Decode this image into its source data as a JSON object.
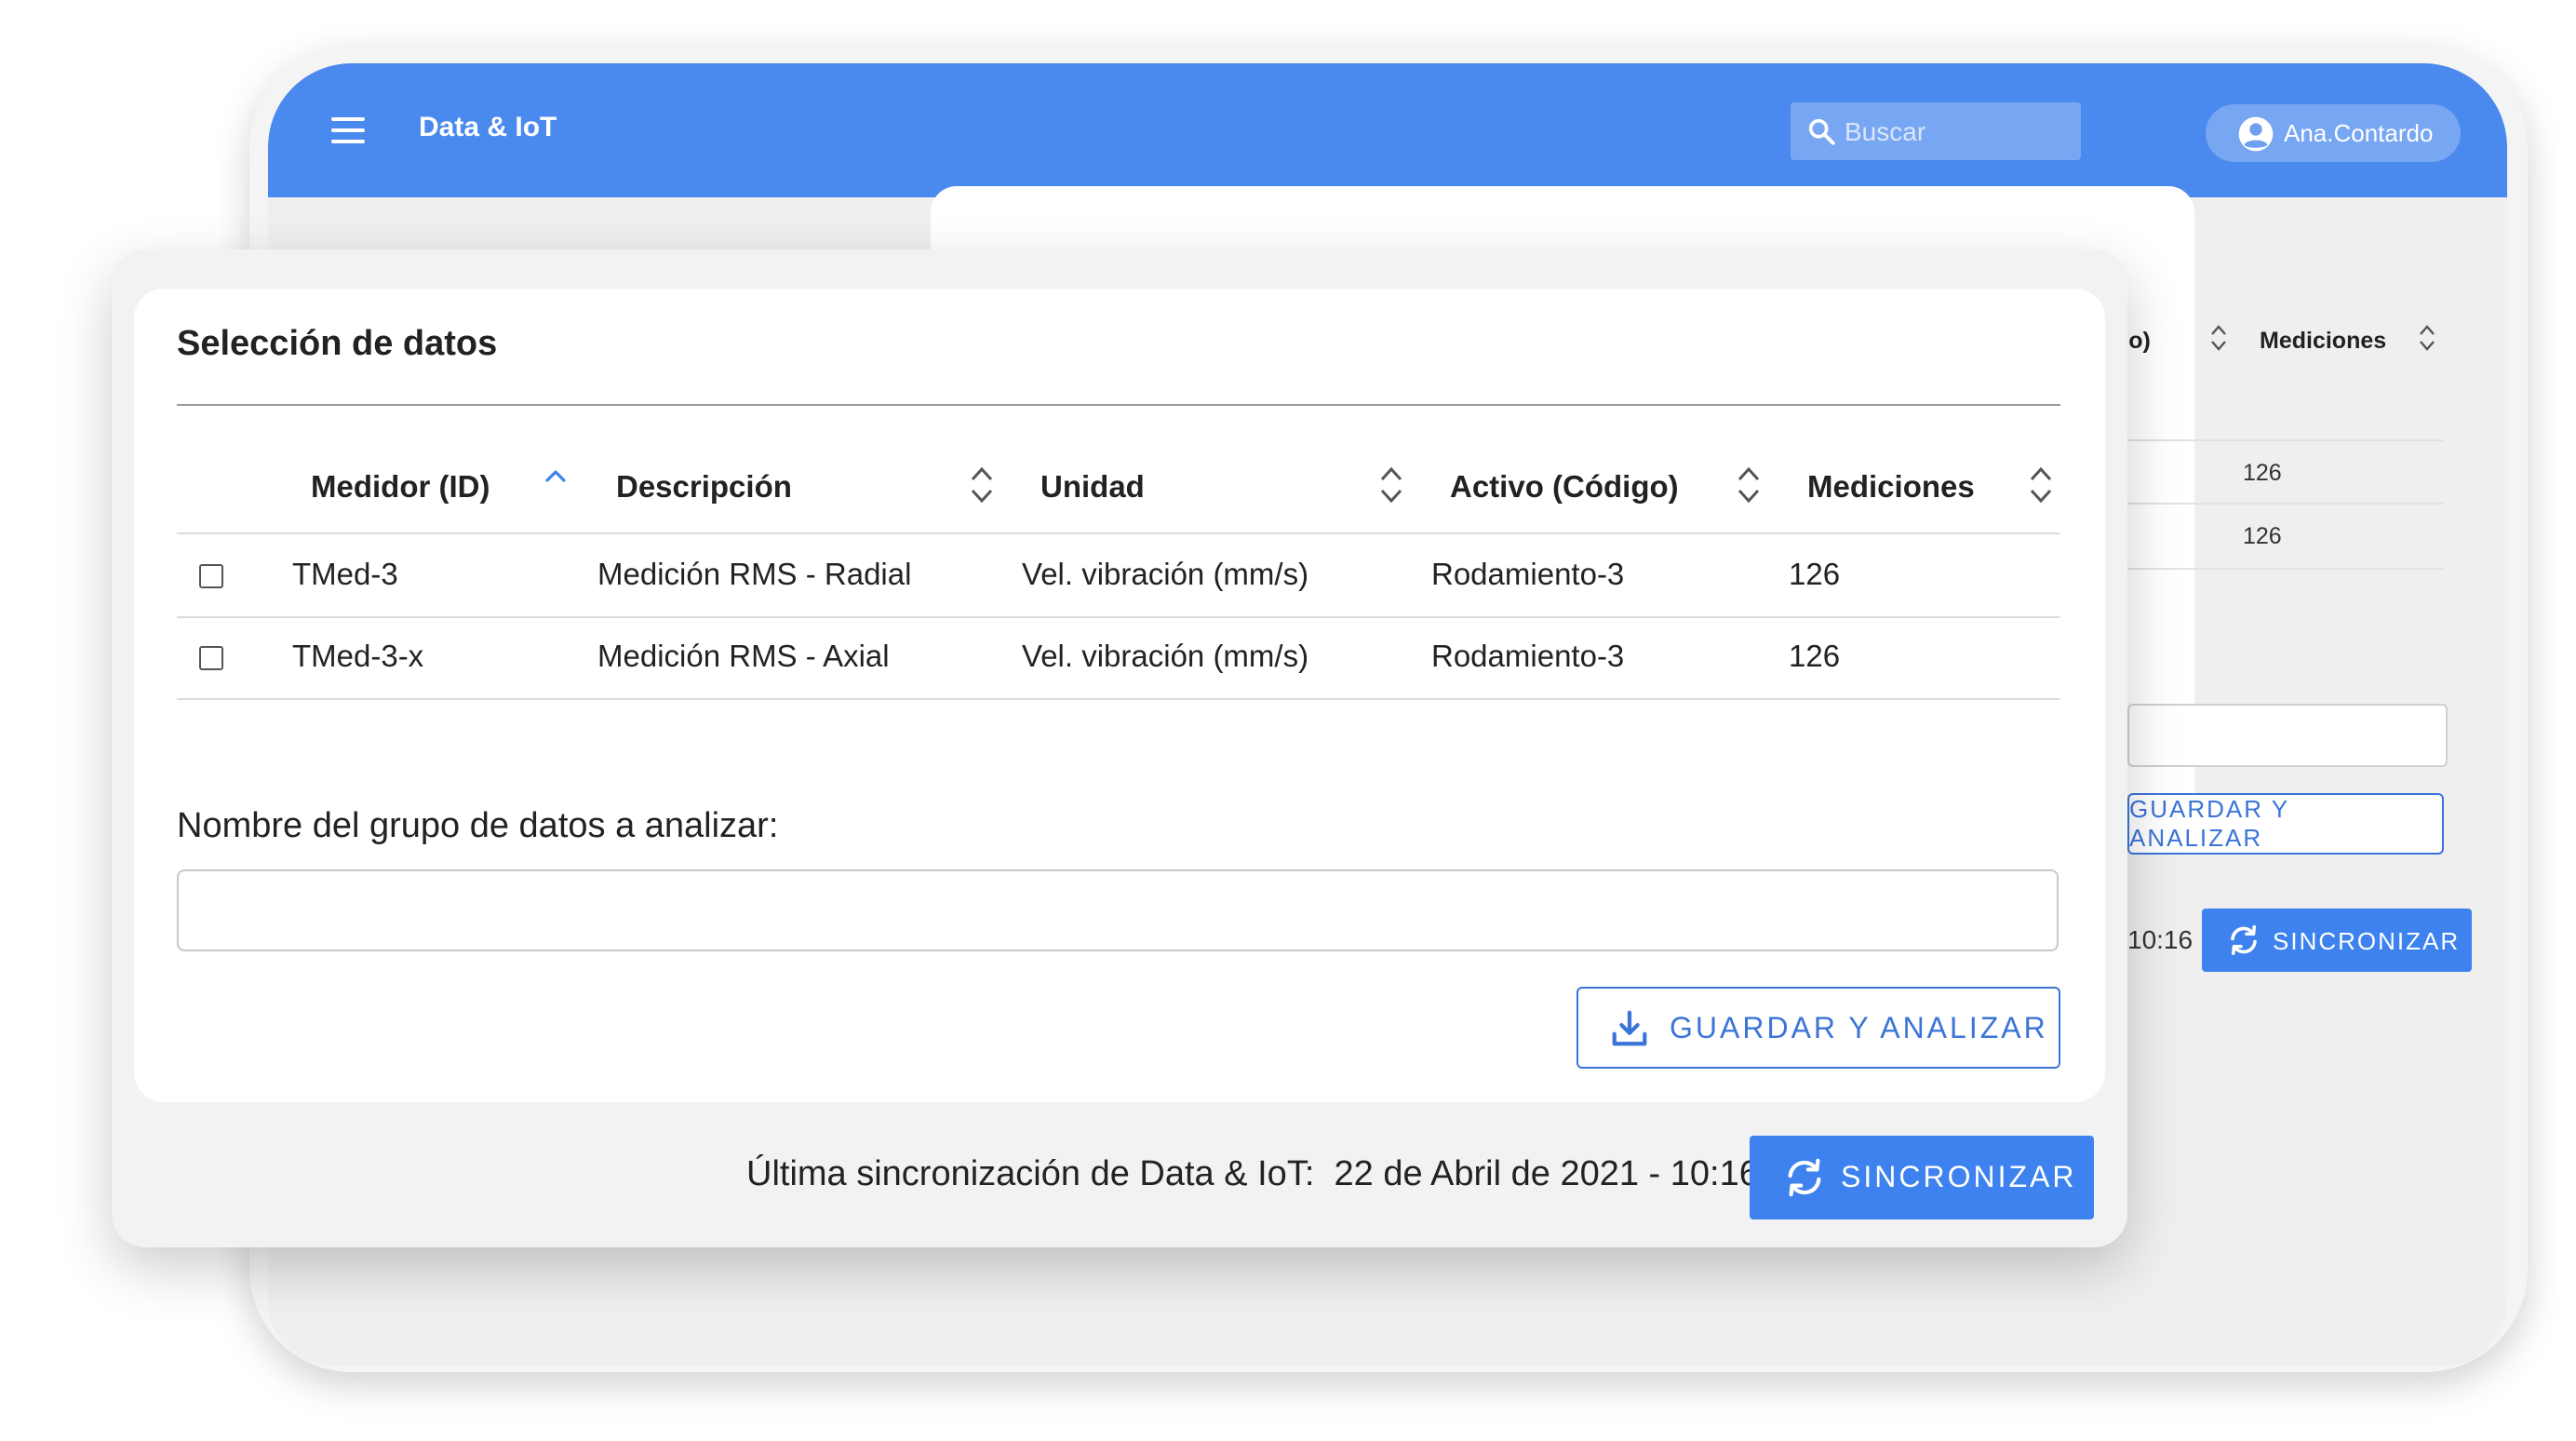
{
  "colors": {
    "appbar": "#4a89ee",
    "primary": "#3d82ee",
    "outline_button": "#3b74d8",
    "panel_bg": "#f2f2f2",
    "card_bg": "#ffffff"
  },
  "background_window": {
    "appbar": {
      "menu_icon": "hamburger-icon",
      "title": "Data & IoT",
      "search": {
        "icon": "search-icon",
        "placeholder": "Buscar"
      },
      "user": {
        "icon": "account-circle-icon",
        "name": "Ana.Contardo"
      }
    },
    "table": {
      "visible_headers": [
        "go)",
        "Mediciones"
      ],
      "rows": [
        {
          "mediciones": "126"
        },
        {
          "mediciones": "126"
        }
      ]
    },
    "save_label": "GUARDAR Y ANALIZAR",
    "sync_time_fragment": "10:16",
    "sync_label": "SINCRONIZAR"
  },
  "data_selection": {
    "title": "Selección de datos",
    "columns": [
      {
        "label": "Medidor (ID)",
        "sort": "ascending"
      },
      {
        "label": "Descripción",
        "sort": "none"
      },
      {
        "label": "Unidad",
        "sort": "none"
      },
      {
        "label": "Activo (Código)",
        "sort": "none"
      },
      {
        "label": "Mediciones",
        "sort": "none"
      }
    ],
    "rows": [
      {
        "checked": false,
        "medidor": "TMed-3",
        "descripcion": "Medición RMS - Radial",
        "unidad": "Vel. vibración (mm/s)",
        "activo": "Rodamiento-3",
        "mediciones": "126"
      },
      {
        "checked": false,
        "medidor": "TMed-3-x",
        "descripcion": "Medición RMS - Axial",
        "unidad": "Vel. vibración (mm/s)",
        "activo": "Rodamiento-3",
        "mediciones": "126"
      }
    ],
    "group_name_label": "Nombre del grupo de datos a analizar:",
    "group_name_value": "",
    "save_button": {
      "icon": "download-icon",
      "label": "GUARDAR Y ANALIZAR"
    }
  },
  "sync_bar": {
    "text": "Última sincronización de Data & IoT:  22 de Abril de 2021 - 10:16",
    "button": {
      "icon": "sync-icon",
      "label": "SINCRONIZAR"
    }
  }
}
